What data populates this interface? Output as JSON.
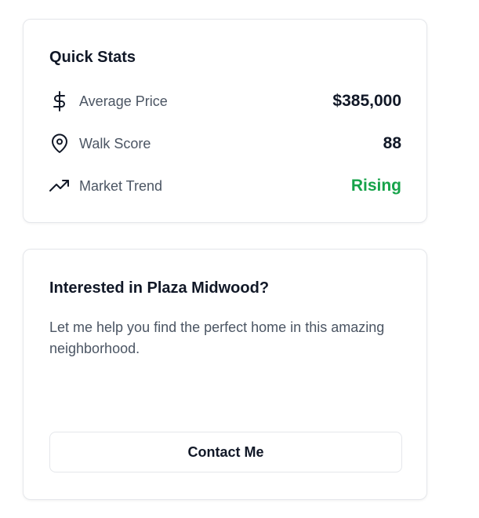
{
  "quick_stats": {
    "title": "Quick Stats",
    "items": [
      {
        "icon": "dollar-icon",
        "label": "Average Price",
        "value": "$385,000"
      },
      {
        "icon": "location-pin-icon",
        "label": "Walk Score",
        "value": "88"
      },
      {
        "icon": "trending-up-icon",
        "label": "Market Trend",
        "value": "Rising",
        "value_color": "#16a34a"
      }
    ]
  },
  "contact": {
    "title": "Interested in Plaza Midwood?",
    "text": "Let me help you find the perfect home in this amazing neighborhood.",
    "button_label": "Contact Me"
  }
}
